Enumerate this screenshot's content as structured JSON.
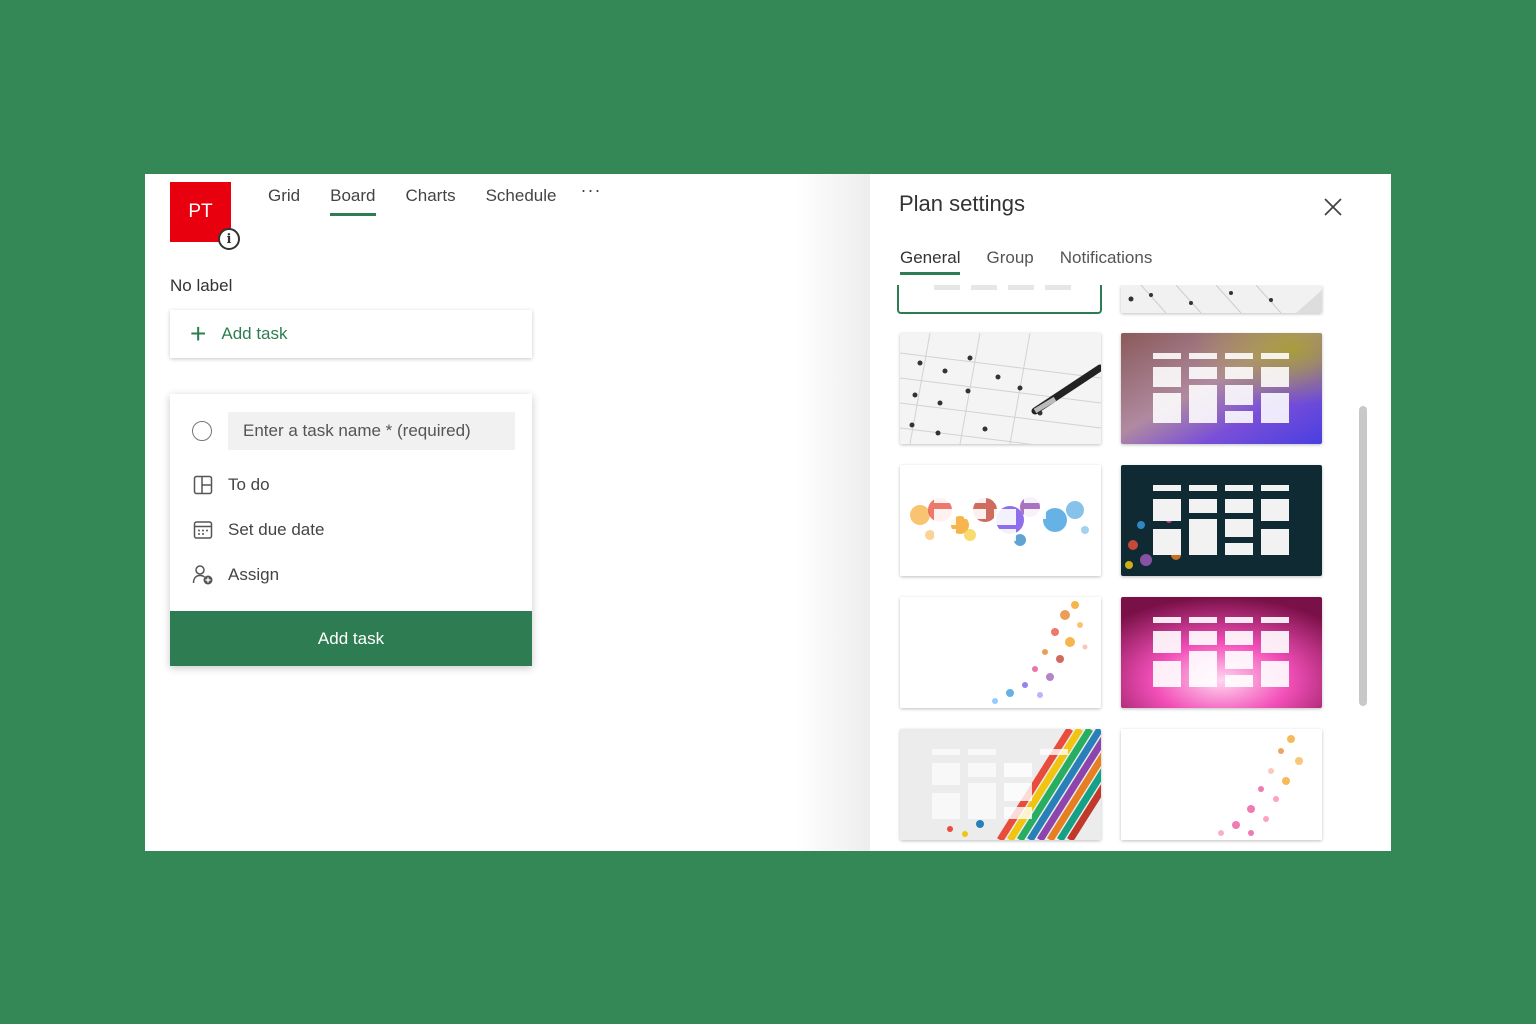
{
  "plan": {
    "initials": "PT",
    "tabs": [
      {
        "label": "Grid"
      },
      {
        "label": "Board"
      },
      {
        "label": "Charts"
      },
      {
        "label": "Schedule"
      }
    ],
    "active_tab": "Board",
    "more_label": "···"
  },
  "bucket": {
    "label": "No label",
    "add_task_label": "Add task"
  },
  "new_task": {
    "placeholder": "Enter a task name * (required)",
    "options": [
      {
        "label": "To do",
        "icon": "bucket-icon"
      },
      {
        "label": "Set due date",
        "icon": "calendar-icon"
      },
      {
        "label": "Assign",
        "icon": "assign-person-icon"
      }
    ],
    "submit_label": "Add task"
  },
  "settings": {
    "title": "Plan settings",
    "tabs": [
      {
        "label": "General"
      },
      {
        "label": "Group"
      },
      {
        "label": "Notifications"
      }
    ],
    "active_tab": "General",
    "backgrounds": [
      "plain (selected)",
      "exam sheet (partial)",
      "exam sheet with pen",
      "purple gradient",
      "rainbow paint splash",
      "dark teal particles",
      "orange dot trail",
      "pink glow",
      "colorful stripes",
      "pink dot trail"
    ]
  },
  "colors": {
    "page_bg": "#348856",
    "accent": "#2e7d52",
    "avatar": "#e8000f"
  }
}
